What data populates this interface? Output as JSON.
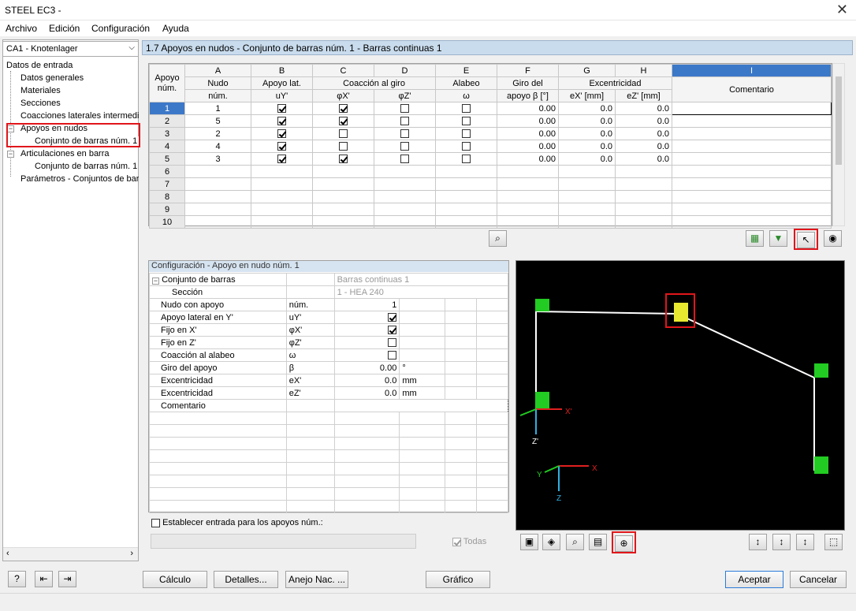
{
  "window": {
    "title": "STEEL EC3 -",
    "close_glyph": "✕"
  },
  "menu": [
    {
      "label": "Archivo"
    },
    {
      "label": "Edición"
    },
    {
      "label": "Configuración"
    },
    {
      "label": "Ayuda"
    }
  ],
  "case_selector": {
    "value": "CA1 - Knotenlager"
  },
  "tree": {
    "root": "Datos de entrada",
    "items": [
      {
        "label": "Datos generales"
      },
      {
        "label": "Materiales"
      },
      {
        "label": "Secciones"
      },
      {
        "label": "Coacciones laterales intermedia"
      },
      {
        "label": "Apoyos en nudos"
      },
      {
        "label": "Conjunto de barras núm. 1"
      },
      {
        "label": "Articulaciones en barra"
      },
      {
        "label": "Conjunto de barras núm. 1"
      },
      {
        "label": "Parámetros - Conjuntos de bar"
      }
    ]
  },
  "section_title": "1.7 Apoyos en nudos - Conjunto de barras núm. 1 - Barras continuas 1",
  "grid": {
    "letters": [
      "A",
      "B",
      "C",
      "D",
      "E",
      "F",
      "G",
      "H",
      "I"
    ],
    "header1": {
      "row": "Apoyo",
      "nudo": "Nudo",
      "lat": "Apoyo lat.",
      "giro": "Coacción al giro",
      "alabeo": "Alabeo",
      "giro_apoyo": "Giro del",
      "exc": "Excentricidad",
      "coment": "Comentario"
    },
    "header2": {
      "row": "núm.",
      "nudo": "núm.",
      "lat": "uY'",
      "phix": "φX'",
      "phiz": "φZ'",
      "alabeo": "ω",
      "giro_apoyo": "apoyo β [°]",
      "ex": "eX' [mm]",
      "ez": "eZ' [mm]"
    },
    "rows": [
      {
        "n": "1",
        "nudo": "1",
        "lat": true,
        "phix": true,
        "phiz": false,
        "alabeo": false,
        "beta": "0.00",
        "ex": "0.0",
        "ez": "0.0"
      },
      {
        "n": "2",
        "nudo": "5",
        "lat": true,
        "phix": true,
        "phiz": false,
        "alabeo": false,
        "beta": "0.00",
        "ex": "0.0",
        "ez": "0.0"
      },
      {
        "n": "3",
        "nudo": "2",
        "lat": true,
        "phix": false,
        "phiz": false,
        "alabeo": false,
        "beta": "0.00",
        "ex": "0.0",
        "ez": "0.0"
      },
      {
        "n": "4",
        "nudo": "4",
        "lat": true,
        "phix": false,
        "phiz": false,
        "alabeo": false,
        "beta": "0.00",
        "ex": "0.0",
        "ez": "0.0"
      },
      {
        "n": "5",
        "nudo": "3",
        "lat": true,
        "phix": true,
        "phiz": false,
        "alabeo": false,
        "beta": "0.00",
        "ex": "0.0",
        "ez": "0.0"
      }
    ],
    "empty_rows": [
      "6",
      "7",
      "8",
      "9",
      "10"
    ]
  },
  "config": {
    "title": "Configuración - Apoyo en nudo núm. 1",
    "conjunto_label": "Conjunto de barras",
    "conjunto_value": "Barras continuas 1",
    "seccion_label": "Sección",
    "seccion_value": "1 - HEA 240",
    "props": [
      {
        "label": "Nudo con apoyo",
        "sym": "núm.",
        "value": "1",
        "unit": "",
        "kind": "text"
      },
      {
        "label": "Apoyo lateral en Y'",
        "sym": "uY'",
        "value": true,
        "unit": "",
        "kind": "check"
      },
      {
        "label": "Fijo en X'",
        "sym": "φX'",
        "value": true,
        "unit": "",
        "kind": "check"
      },
      {
        "label": "Fijo en Z'",
        "sym": "φZ'",
        "value": false,
        "unit": "",
        "kind": "check"
      },
      {
        "label": "Coacción al alabeo",
        "sym": "ω",
        "value": false,
        "unit": "",
        "kind": "check"
      },
      {
        "label": "Giro del apoyo",
        "sym": "β",
        "value": "0.00",
        "unit": "°",
        "kind": "text"
      },
      {
        "label": "Excentricidad",
        "sym": "eX'",
        "value": "0.0",
        "unit": "mm",
        "kind": "text"
      },
      {
        "label": "Excentricidad",
        "sym": "eZ'",
        "value": "0.0",
        "unit": "mm",
        "kind": "text"
      },
      {
        "label": "Comentario",
        "sym": "",
        "value": "",
        "unit": "",
        "kind": "text"
      }
    ],
    "establecer_label": "Establecer entrada para los apoyos núm.:",
    "todas_label": "Todas"
  },
  "view3d": {
    "axis_x_local": "X'",
    "axis_z_local": "Z'",
    "axis_x": "X",
    "axis_y": "Y",
    "axis_z": "Z"
  },
  "buttons": {
    "calculo": "Cálculo",
    "detalles": "Detalles...",
    "anejo": "Anejo Nac. ...",
    "grafico": "Gráfico",
    "aceptar": "Aceptar",
    "cancelar": "Cancelar"
  },
  "colors": {
    "accent": "#3c78c8",
    "header": "#c9dced",
    "highlight": "#e0161b",
    "support": "#22cc22",
    "selected_support": "#e8e830"
  }
}
